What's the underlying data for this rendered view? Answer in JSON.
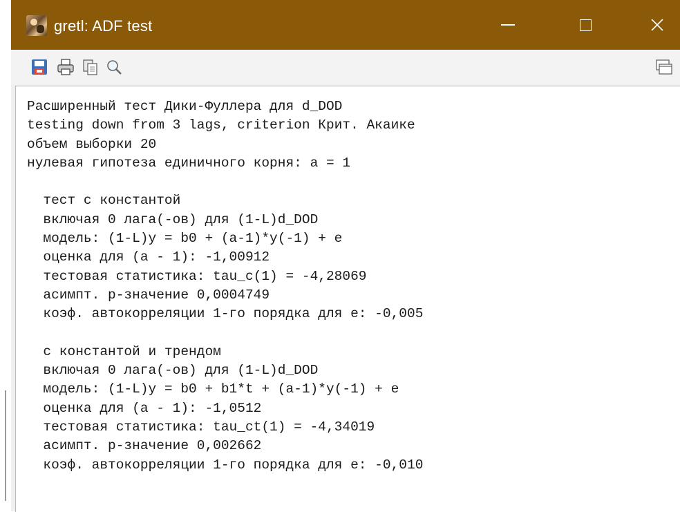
{
  "window": {
    "title": "gretl: ADF test"
  },
  "toolbar": {
    "icons": [
      "save-icon",
      "print-icon",
      "copy-icon",
      "find-icon",
      "window-icon"
    ]
  },
  "output": {
    "lines": [
      "Расширенный тест Дики-Фуллера для d_DOD",
      "testing down from 3 lags, criterion Крит. Акаике",
      "объем выборки 20",
      "нулевая гипотеза единичного корня: a = 1",
      "",
      "  тест с константой",
      "  включая 0 лага(-ов) для (1-L)d_DOD",
      "  модель: (1-L)y = b0 + (a-1)*y(-1) + e",
      "  оценка для (a - 1): -1,00912",
      "  тестовая статистика: tau_c(1) = -4,28069",
      "  асимпт. p-значение 0,0004749",
      "  коэф. автокорреляции 1-го порядка для e: -0,005",
      "",
      "  с константой и трендом",
      "  включая 0 лага(-ов) для (1-L)d_DOD",
      "  модель: (1-L)y = b0 + b1*t + (a-1)*y(-1) + e",
      "  оценка для (a - 1): -1,0512",
      "  тестовая статистика: tau_ct(1) = -4,34019",
      "  асимпт. p-значение 0,002662",
      "  коэф. автокорреляции 1-го порядка для e: -0,010"
    ]
  },
  "colors": {
    "titlebar": "#8a5a08",
    "title_text": "#ffffff",
    "toolbar": "#f3f3f3",
    "content_bg": "#ffffff"
  }
}
